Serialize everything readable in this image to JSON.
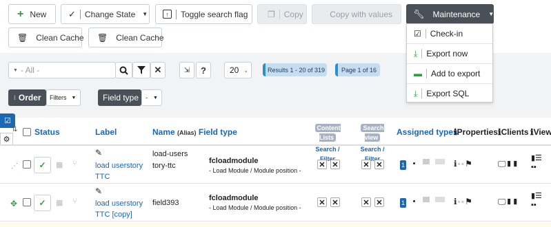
{
  "toolbar": {
    "new_label": "New",
    "change_state_label": "Change State",
    "toggle_search_label": "Toggle search flag",
    "copy_label": "Copy",
    "copy_values_label": "Copy with values",
    "maintenance_label": "Maintenance",
    "clean_cache_1": "Clean Cache",
    "clean_cache_2": "Clean Cache"
  },
  "maintenance_menu": [
    {
      "label": "Check-in",
      "icon": "checkbox-icon"
    },
    {
      "label": "Export now",
      "icon": "download-icon"
    },
    {
      "label": "Add to export",
      "icon": "archive-icon"
    },
    {
      "label": "Export SQL",
      "icon": "download-icon"
    }
  ],
  "filter": {
    "search_placeholder": "- All -",
    "page_size": "20",
    "results_text": "Results 1 - 20 of 319",
    "page_text": "Page 1 of 16",
    "order_label": "Order",
    "filters_label": "Filters",
    "field_type_label": "Field type",
    "field_type_value": "-"
  },
  "table": {
    "headers": {
      "status": "Status",
      "label": "Label",
      "name": "Name",
      "alias": "(Alias)",
      "field_type": "Field type",
      "content_lists": "Content Lists",
      "search_view": "Search view",
      "search_filter_1": "Search / Filter",
      "search_filter_2": "Search / Filter",
      "assigned_types": "Assigned types",
      "properties": "Properties",
      "clients": "Clients",
      "view": "View"
    },
    "rows": [
      {
        "label": "load userstory TTC",
        "name": "load-userstory-ttc",
        "type": "fcloadmodule",
        "type_desc": "- Load Module / Module position -",
        "assigned": "1"
      },
      {
        "label": "load userstory TTC [copy]",
        "name": "field393",
        "type": "fcloadmodule",
        "type_desc": "- Load Module / Module position -",
        "assigned": "1"
      }
    ]
  },
  "colors": {
    "accent": "#1a67b4",
    "dark": "#495057",
    "success": "#2e9e45"
  }
}
